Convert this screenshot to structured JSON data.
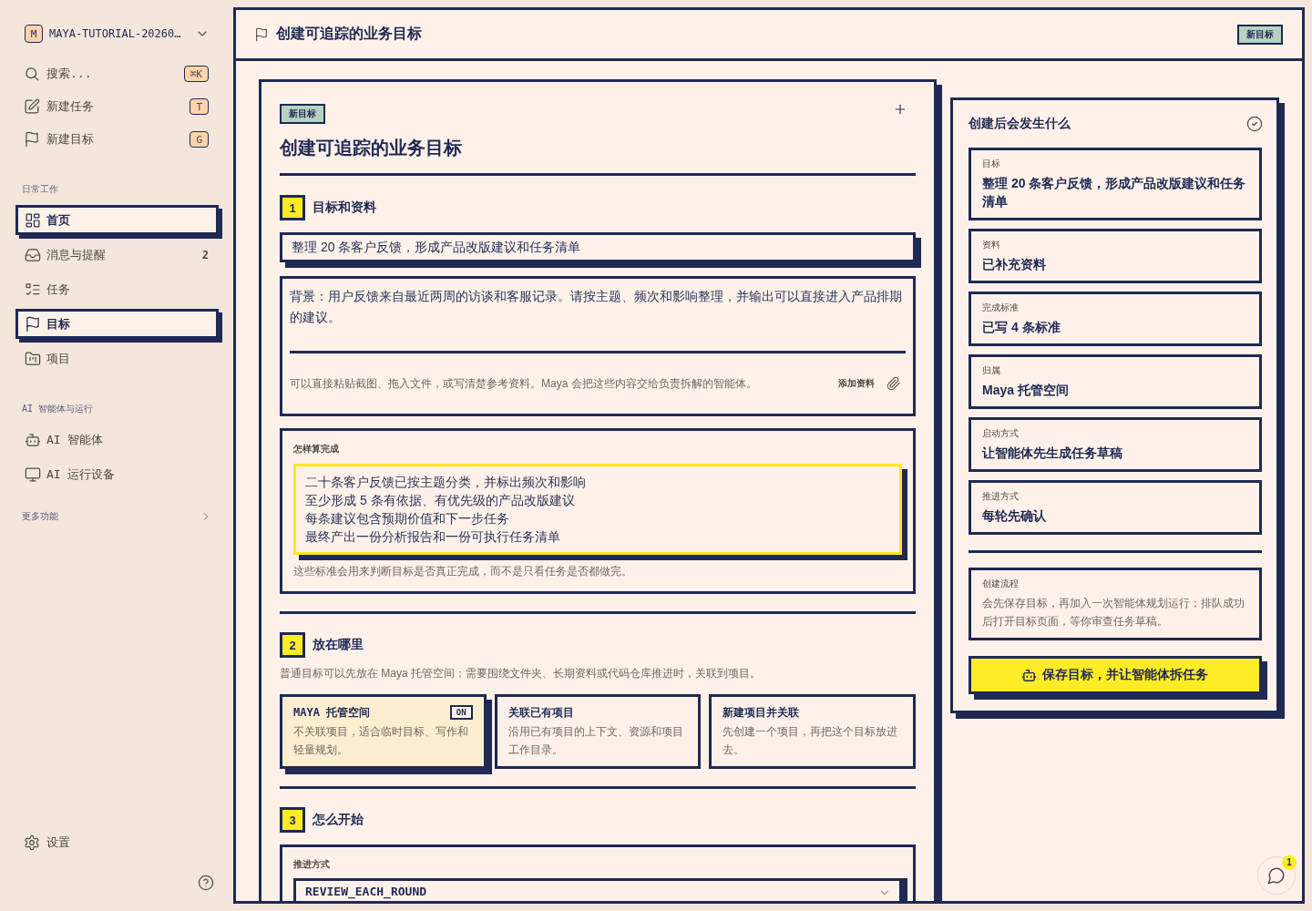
{
  "sidebar": {
    "workspace": {
      "initial": "M",
      "name": "MAYA-TUTORIAL-20260…"
    },
    "actions": [
      {
        "label": "搜索...",
        "shortcut": "⌘K"
      },
      {
        "label": "新建任务",
        "shortcut": "T"
      },
      {
        "label": "新建目标",
        "shortcut": "G"
      }
    ],
    "groups": [
      {
        "title": "日常工作",
        "items": [
          {
            "label": "首页",
            "selected": true
          },
          {
            "label": "消息与提醒",
            "selected": false,
            "count": "2"
          },
          {
            "label": "任务",
            "selected": false
          },
          {
            "label": "目标",
            "selected": true
          },
          {
            "label": "项目",
            "selected": false
          }
        ]
      },
      {
        "title": "AI 智能体与运行",
        "items": [
          {
            "label": "AI 智能体",
            "selected": false
          },
          {
            "label": "AI 运行设备",
            "selected": false
          }
        ]
      }
    ],
    "more": {
      "label": "更多功能"
    },
    "settings": {
      "label": "设置"
    }
  },
  "header": {
    "title": "创建可追踪的业务目标",
    "tag": "新目标"
  },
  "form": {
    "tag": "新目标",
    "title": "创建可追踪的业务目标",
    "goal_section": {
      "number": "1",
      "title": "目标和资料",
      "goal_input": {
        "value": "整理 20 条客户反馈，形成产品改版建议和任务清单"
      },
      "background_input": {
        "value": "背景：用户反馈来自最近两周的访谈和客服记录。请按主题、频次和影响整理，并输出可以直接进入产品排期的建议。"
      },
      "material_hint": "可以直接粘贴截图、拖入文件，或写清楚参考资料。Maya 会把这些内容交给负责拆解的智能体。",
      "attach_label": "添加资料",
      "criteria": {
        "label": "怎样算完成",
        "lines": [
          "二十条客户反馈已按主题分类，并标出频次和影响",
          "至少形成 5 条有依据、有优先级的产品改版建议",
          "每条建议包含预期价值和下一步任务",
          "最终产出一份分析报告和一份可执行任务清单"
        ],
        "hint": "这些标准会用来判断目标是否真正完成，而不是只看任务是否都做完。"
      }
    },
    "placement_section": {
      "number": "2",
      "title": "放在哪里",
      "description": "普通目标可以先放在 Maya 托管空间；需要围绕文件夹、长期资料或代码仓库推进时，关联到项目。",
      "options": [
        {
          "title": "MAYA 托管空间",
          "description": "不关联项目，适合临时目标、写作和轻量规划。",
          "selected": true,
          "tag": "ON"
        },
        {
          "title": "关联已有项目",
          "description": "沿用已有项目的上下文、资源和项目工作目录。",
          "selected": false
        },
        {
          "title": "新建项目并关联",
          "description": "先创建一个项目，再把这个目标放进去。",
          "selected": false
        }
      ]
    },
    "start_section": {
      "number": "3",
      "title": "怎么开始",
      "mode": {
        "label": "推进方式",
        "value": "REVIEW_EACH_ROUND"
      }
    }
  },
  "summary": {
    "title": "创建后会发生什么",
    "items": [
      {
        "label": "目标",
        "value": "整理 20 条客户反馈，形成产品改版建议和任务清单"
      },
      {
        "label": "资料",
        "value": "已补充资料"
      },
      {
        "label": "完成标准",
        "value": "已写 4 条标准"
      },
      {
        "label": "归属",
        "value": "Maya 托管空间"
      },
      {
        "label": "启动方式",
        "value": "让智能体先生成任务草稿"
      },
      {
        "label": "推进方式",
        "value": "每轮先确认"
      }
    ],
    "flow": {
      "label": "创建流程",
      "text": "会先保存目标，再加入一次智能体规划运行；排队成功后打开目标页面，等你审查任务草稿。"
    },
    "submit": "保存目标，并让智能体拆任务"
  },
  "chat": {
    "unread": "1"
  }
}
